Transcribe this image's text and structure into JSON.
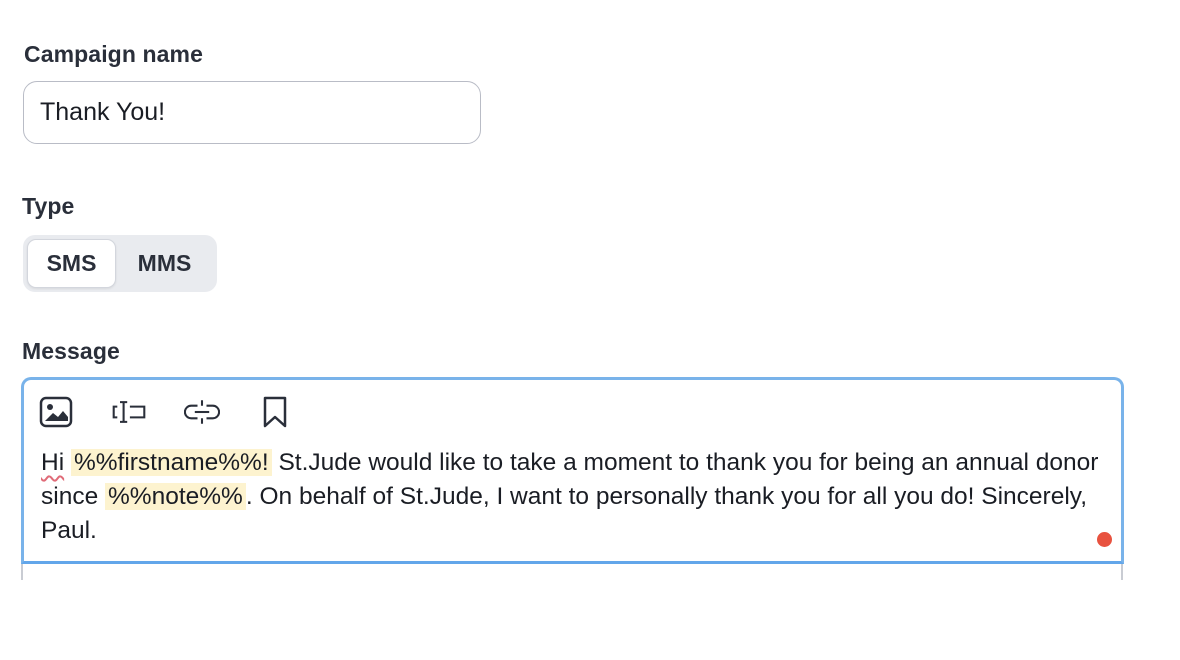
{
  "campaign": {
    "label": "Campaign name",
    "value": "Thank You!"
  },
  "type": {
    "label": "Type",
    "options": [
      "SMS",
      "MMS"
    ],
    "selected": "SMS"
  },
  "message": {
    "label": "Message",
    "toolbar": {
      "icons": [
        "image-icon",
        "insert-field-icon",
        "link-icon",
        "bookmark-icon"
      ]
    },
    "text": {
      "greeting": "Hi",
      "firstname_token": "%%firstname%%!",
      "part1": " St.Jude would like to take a moment to thank you for being an annual donor since ",
      "note_token": "%%note%%",
      "part2": ". On behalf of St.Jude, I want to personally thank you for all you do! Sincerely, Paul."
    }
  },
  "colors": {
    "focus_border": "#79b3ea",
    "token_highlight": "#fdf3cf",
    "status_dot": "#e8523f"
  }
}
